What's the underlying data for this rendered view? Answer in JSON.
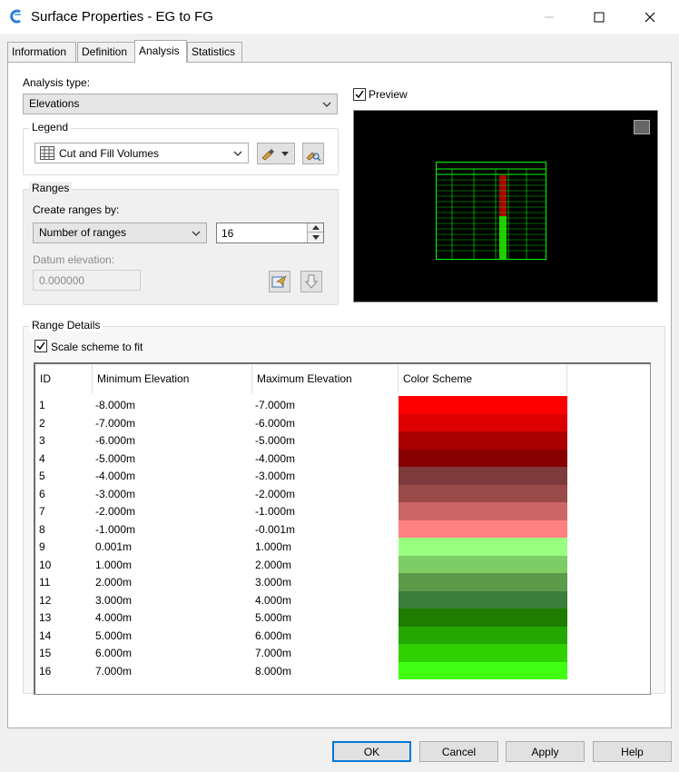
{
  "window": {
    "title": "Surface Properties - EG to FG"
  },
  "tabs": [
    {
      "label": "Information"
    },
    {
      "label": "Definition"
    },
    {
      "label": "Analysis"
    },
    {
      "label": "Statistics"
    }
  ],
  "analysis": {
    "type_label": "Analysis type:",
    "type_value": "Elevations",
    "preview_label": "Preview",
    "preview_checked": true
  },
  "legend": {
    "group_label": "Legend",
    "value": "Cut and Fill Volumes"
  },
  "ranges": {
    "group_label": "Ranges",
    "create_label": "Create ranges by:",
    "create_value": "Number of ranges",
    "count": "16",
    "datum_label": "Datum elevation:",
    "datum_value": "0.000000"
  },
  "range_details": {
    "group_label": "Range Details",
    "scale_label": "Scale scheme to fit",
    "scale_checked": true,
    "columns": [
      "ID",
      "Minimum Elevation",
      "Maximum Elevation",
      "Color Scheme"
    ],
    "rows": [
      {
        "id": "1",
        "min": "-8.000m",
        "max": "-7.000m",
        "color": "#ff0000"
      },
      {
        "id": "2",
        "min": "-7.000m",
        "max": "-6.000m",
        "color": "#dd0000"
      },
      {
        "id": "3",
        "min": "-6.000m",
        "max": "-5.000m",
        "color": "#aa0000"
      },
      {
        "id": "4",
        "min": "-5.000m",
        "max": "-4.000m",
        "color": "#880000"
      },
      {
        "id": "5",
        "min": "-4.000m",
        "max": "-3.000m",
        "color": "#7d3b3b"
      },
      {
        "id": "6",
        "min": "-3.000m",
        "max": "-2.000m",
        "color": "#9b4a4a"
      },
      {
        "id": "7",
        "min": "-2.000m",
        "max": "-1.000m",
        "color": "#cc6666"
      },
      {
        "id": "8",
        "min": "-1.000m",
        "max": "-0.001m",
        "color": "#ff8080"
      },
      {
        "id": "9",
        "min": "0.001m",
        "max": "1.000m",
        "color": "#99ff80"
      },
      {
        "id": "10",
        "min": "1.000m",
        "max": "2.000m",
        "color": "#7dcc66"
      },
      {
        "id": "11",
        "min": "2.000m",
        "max": "3.000m",
        "color": "#5b9b4a"
      },
      {
        "id": "12",
        "min": "3.000m",
        "max": "4.000m",
        "color": "#3b7d3b"
      },
      {
        "id": "13",
        "min": "4.000m",
        "max": "5.000m",
        "color": "#1e7d00"
      },
      {
        "id": "14",
        "min": "5.000m",
        "max": "6.000m",
        "color": "#22a800"
      },
      {
        "id": "15",
        "min": "6.000m",
        "max": "7.000m",
        "color": "#2fd100"
      },
      {
        "id": "16",
        "min": "7.000m",
        "max": "8.000m",
        "color": "#40ff10"
      }
    ]
  },
  "buttons": {
    "ok": "OK",
    "cancel": "Cancel",
    "apply": "Apply",
    "help": "Help"
  },
  "colors": {
    "accent": "#0078d7",
    "preview_bg": "#000000",
    "preview_table": "#00ff00"
  }
}
